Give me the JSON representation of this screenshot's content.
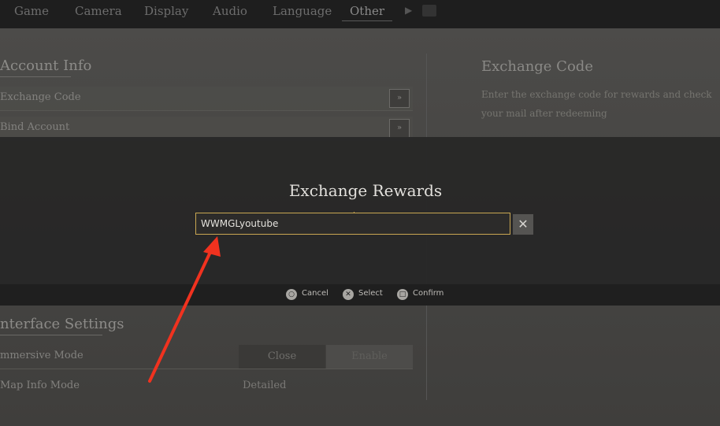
{
  "tabs": [
    {
      "label": "Game",
      "active": false
    },
    {
      "label": "Camera",
      "active": false
    },
    {
      "label": "Display",
      "active": false
    },
    {
      "label": "Audio",
      "active": false
    },
    {
      "label": "Language",
      "active": false
    },
    {
      "label": "Other",
      "active": true
    }
  ],
  "account": {
    "title": "Account Info",
    "rows": [
      {
        "label": "Exchange Code",
        "button": "»"
      },
      {
        "label": "Bind Account",
        "button": "»"
      }
    ]
  },
  "interface": {
    "title": "nterface Settings",
    "immersive_label": "mmersive Mode",
    "immersive_options": [
      "Close",
      "Enable"
    ],
    "map_label": "Map Info Mode",
    "map_value": "Detailed"
  },
  "right_panel": {
    "title": "Exchange Code",
    "description": "Enter the exchange code for rewards and check your mail after redeeming"
  },
  "modal": {
    "title": "Exchange Rewards",
    "input_value": "WWMGLyoutube",
    "clear_icon": "close-icon"
  },
  "hints": [
    {
      "icon": "circle-button-icon",
      "label": "Cancel"
    },
    {
      "icon": "cross-button-icon",
      "label": "Select"
    },
    {
      "icon": "square-button-icon",
      "label": "Confirm"
    }
  ],
  "colors": {
    "accent": "#c9a752",
    "annotation_arrow": "#f0321f"
  }
}
